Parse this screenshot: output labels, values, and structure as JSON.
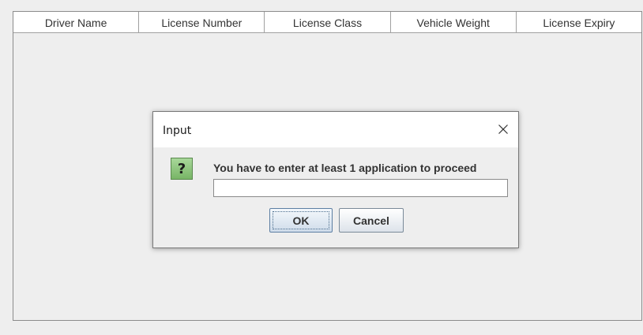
{
  "table": {
    "columns": [
      "Driver Name",
      "License Number",
      "License Class",
      "Vehicle Weight",
      "License Expiry"
    ]
  },
  "dialog": {
    "title": "Input",
    "close_glyph": "×",
    "icon": "question-icon",
    "icon_glyph": "?",
    "message": "You have to enter at least 1 application to proceed",
    "input_value": "",
    "ok_label": "OK",
    "cancel_label": "Cancel"
  },
  "colors": {
    "background": "#eeeeee",
    "header_background": "#ffffff",
    "icon_green": "#78b566",
    "button_border": "#7a8a99"
  }
}
